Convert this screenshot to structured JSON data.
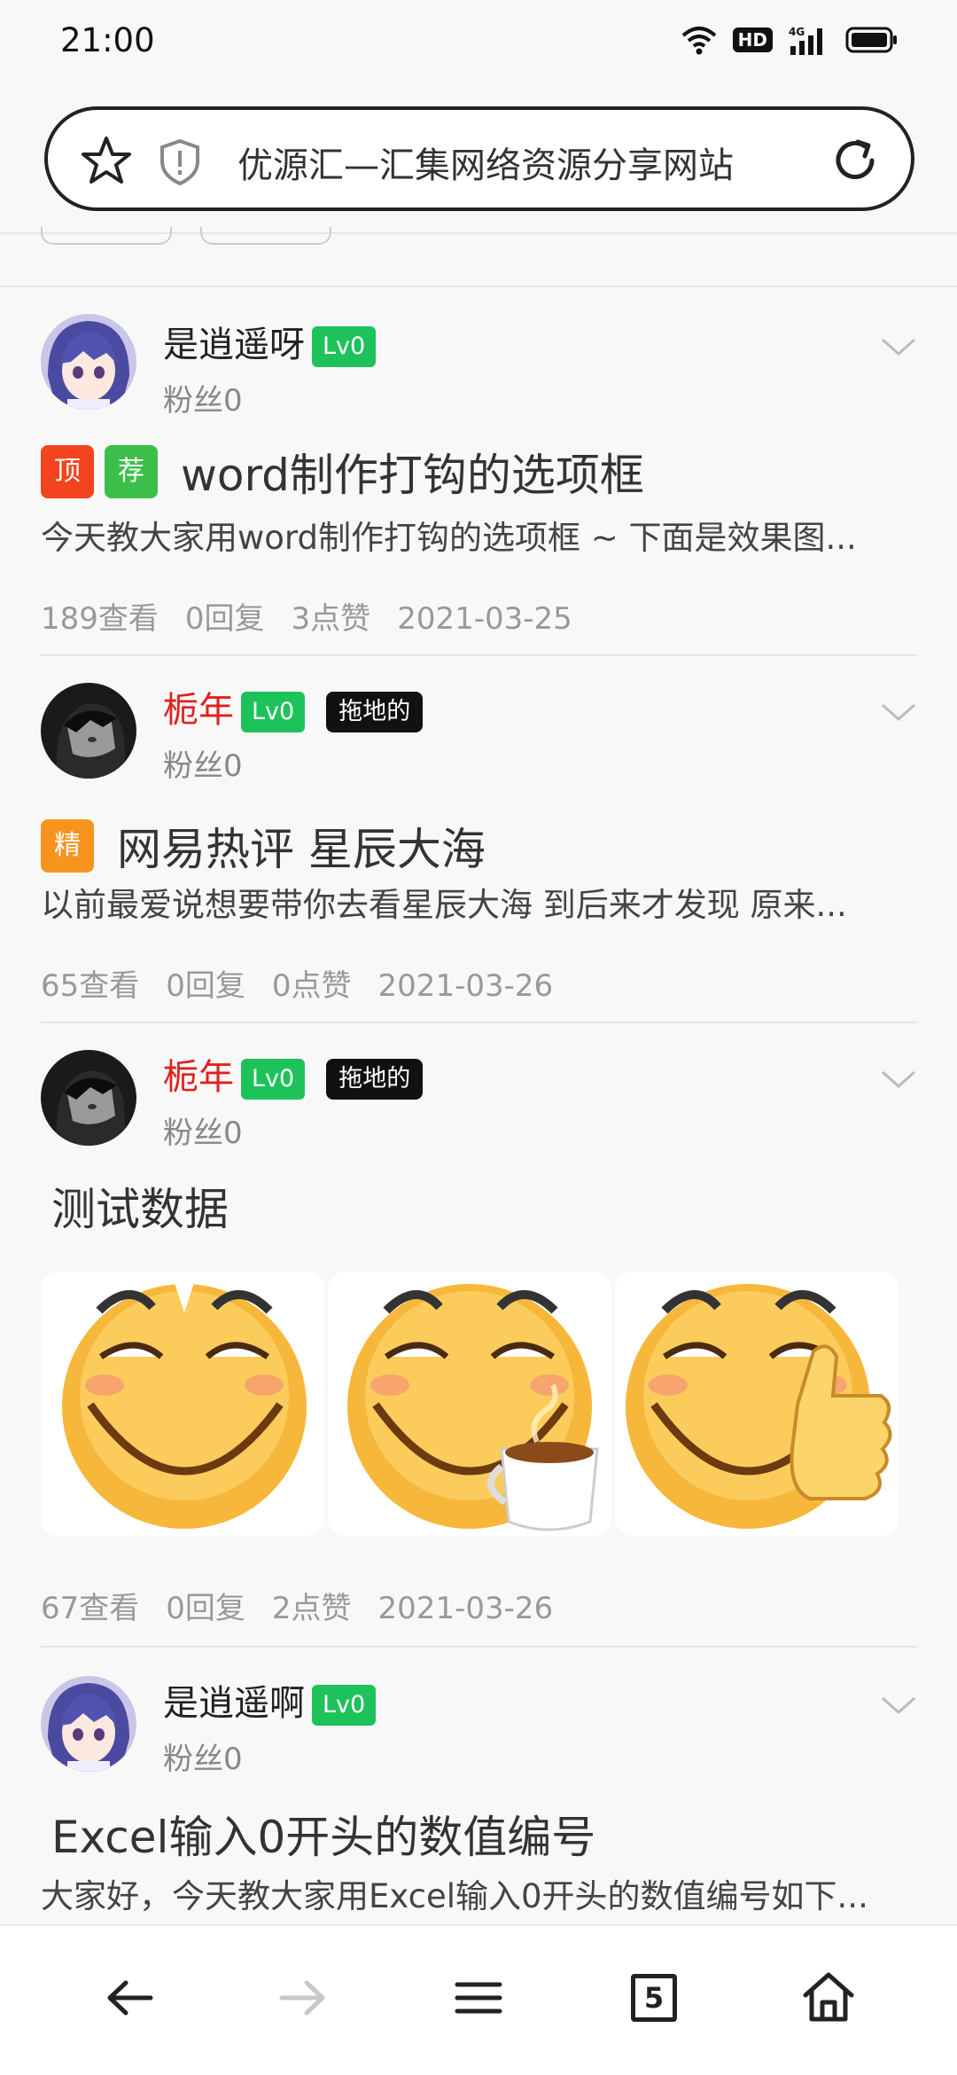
{
  "status_bar": {
    "time": "21:00",
    "hd": "HD",
    "network": "4G"
  },
  "address_bar": {
    "title": "优源汇—汇集网络资源分享网站"
  },
  "posts": [
    {
      "author": "是逍遥呀",
      "author_color": "#222222",
      "level": "Lv0",
      "fans": "粉丝0",
      "badges": [
        {
          "text": "顶",
          "color": "#f4431f"
        },
        {
          "text": "荐",
          "color": "#3cbf4a"
        }
      ],
      "title": "word制作打钩的选项框",
      "excerpt": "今天教大家用word制作打钩的选项框 ~ 下面是效果图...",
      "views": "189查看",
      "replies": "0回复",
      "likes": "3点赞",
      "date": "2021-03-25"
    },
    {
      "author": "栀年",
      "author_color": "#e02020",
      "level": "Lv0",
      "tag": "拖地的",
      "fans": "粉丝0",
      "badges": [
        {
          "text": "精",
          "color": "#f7941d"
        }
      ],
      "title": "网易热评 星辰大海",
      "excerpt": "以前最爱说想要带你去看星辰大海 到后来才发现 原来...",
      "views": "65查看",
      "replies": "0回复",
      "likes": "0点赞",
      "date": "2021-03-26"
    },
    {
      "author": "栀年",
      "author_color": "#e02020",
      "level": "Lv0",
      "tag": "拖地的",
      "fans": "粉丝0",
      "title": "测试数据",
      "images": [
        "smile-emoji",
        "tea-emoji",
        "thumbs-up-emoji"
      ],
      "views": "67查看",
      "replies": "0回复",
      "likes": "2点赞",
      "date": "2021-03-26"
    },
    {
      "author": "是逍遥啊",
      "author_color": "#222222",
      "level": "Lv0",
      "fans": "粉丝0",
      "title": "Excel输入0开头的数值编号",
      "excerpt": "大家好，今天教大家用Excel输入0开头的数值编号如下..."
    }
  ],
  "bottom_nav": {
    "tabs_count": "5"
  }
}
